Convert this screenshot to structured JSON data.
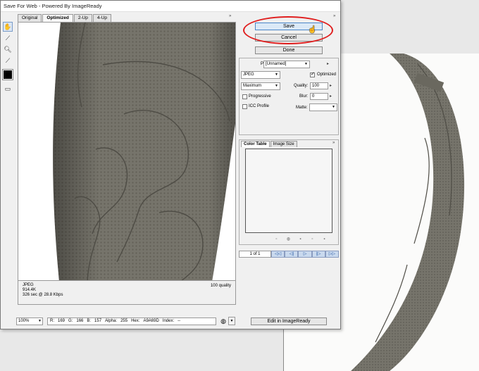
{
  "dialog": {
    "title": "Save For Web - Powered By ImageReady"
  },
  "tabs": [
    {
      "label": "Original",
      "selected": false
    },
    {
      "label": "Optimized",
      "selected": true
    },
    {
      "label": "2-Up",
      "selected": false
    },
    {
      "label": "4-Up",
      "selected": false
    }
  ],
  "tools": {
    "hand": "hand-icon",
    "slice_select": "slice-select-icon",
    "zoom": "zoom-icon",
    "eyedropper": "eyedropper-icon",
    "eyedropper_color": "#000000",
    "preview_toggle": "preview-toggle-icon"
  },
  "buttons": {
    "save": "Save",
    "cancel": "Cancel",
    "done": "Done",
    "edit_in_imageready": "Edit in ImageReady"
  },
  "settings": {
    "preset_label": "Preset:",
    "preset_value": "[Unnamed]",
    "format_value": "JPEG",
    "optimized_label": "Optimized",
    "optimized_checked": true,
    "quality_level": "Maximum",
    "quality_label": "Quality:",
    "quality_value": "100",
    "progressive_label": "Progressive",
    "progressive_checked": false,
    "blur_label": "Blur:",
    "blur_value": "0",
    "icc_label": "ICC Profile",
    "icc_checked": false,
    "matte_label": "Matte:"
  },
  "color_tabs": [
    {
      "label": "Color Table",
      "selected": true
    },
    {
      "label": "Image Size",
      "selected": false
    }
  ],
  "navigation": {
    "page": "1 of 1"
  },
  "info": {
    "format": "JPEG",
    "size": "914.4K",
    "time": "326 sec @ 28.8 Kbps",
    "quality": "100 quality"
  },
  "status": {
    "zoom": "100%",
    "r_label": "R:",
    "r": "169",
    "g_label": "G:",
    "g": "166",
    "b_label": "B:",
    "b": "157",
    "alpha_label": "Alpha:",
    "alpha": "255",
    "hex_label": "Hex:",
    "hex": "A9A69D",
    "index_label": "Index:",
    "index": "--"
  },
  "colors": {
    "wheel": "#76746b",
    "wheel_dark": "#5a584f",
    "highlight_oval": "#e01e1e",
    "accent_button": "#dbe9f7"
  }
}
